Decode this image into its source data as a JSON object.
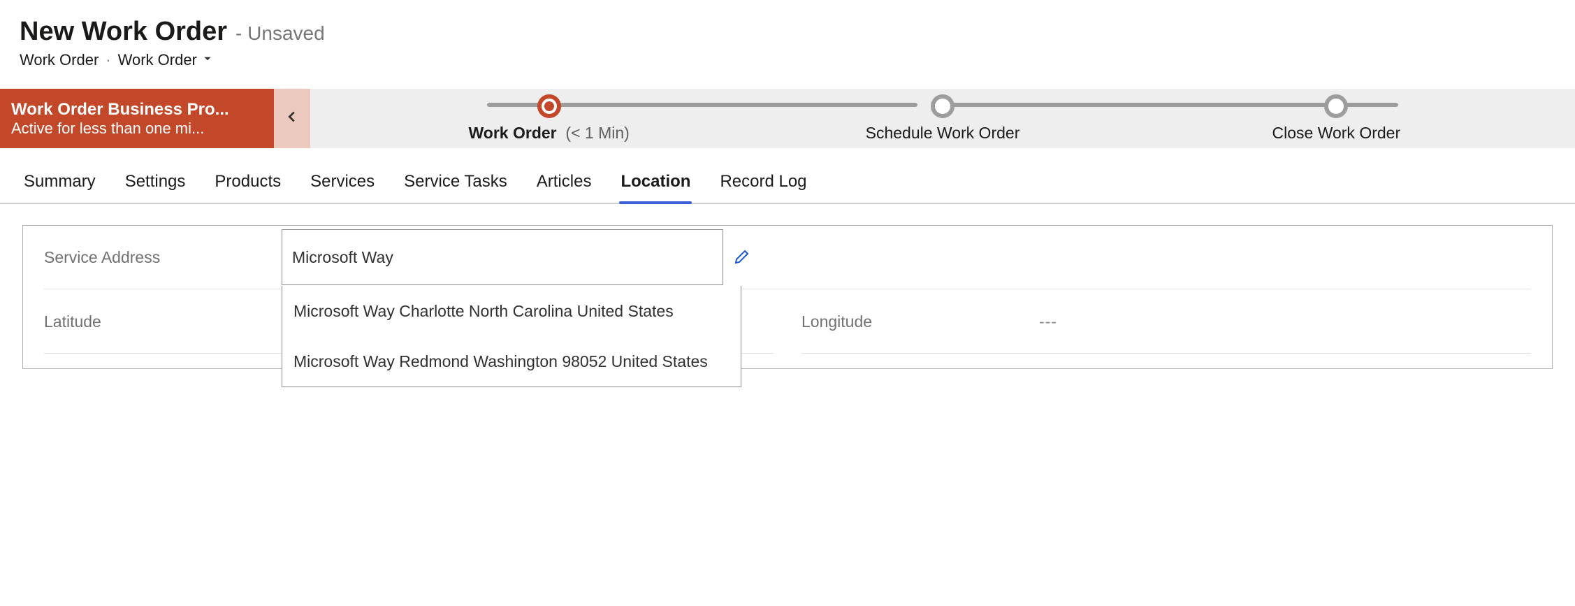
{
  "header": {
    "title": "New Work Order",
    "status_prefix": "- ",
    "status": "Unsaved",
    "entity": "Work Order",
    "form": "Work Order"
  },
  "bpf": {
    "process_name": "Work Order Business Pro...",
    "active_text": "Active for less than one mi...",
    "stages": [
      {
        "label": "Work Order",
        "duration": "(< 1 Min)",
        "active": true
      },
      {
        "label": "Schedule Work Order",
        "duration": "",
        "active": false
      },
      {
        "label": "Close Work Order",
        "duration": "",
        "active": false
      }
    ]
  },
  "tabs": [
    {
      "id": "summary",
      "label": "Summary",
      "active": false
    },
    {
      "id": "settings",
      "label": "Settings",
      "active": false
    },
    {
      "id": "products",
      "label": "Products",
      "active": false
    },
    {
      "id": "services",
      "label": "Services",
      "active": false
    },
    {
      "id": "service-tasks",
      "label": "Service Tasks",
      "active": false
    },
    {
      "id": "articles",
      "label": "Articles",
      "active": false
    },
    {
      "id": "location",
      "label": "Location",
      "active": true
    },
    {
      "id": "record-log",
      "label": "Record Log",
      "active": false
    }
  ],
  "fields": {
    "service_address": {
      "label": "Service Address",
      "value": "Microsoft Way"
    },
    "latitude": {
      "label": "Latitude",
      "value": "---"
    },
    "longitude": {
      "label": "Longitude",
      "value": "---"
    }
  },
  "suggestions": [
    "Microsoft Way Charlotte North Carolina United States",
    "Microsoft Way Redmond Washington 98052 United States"
  ]
}
